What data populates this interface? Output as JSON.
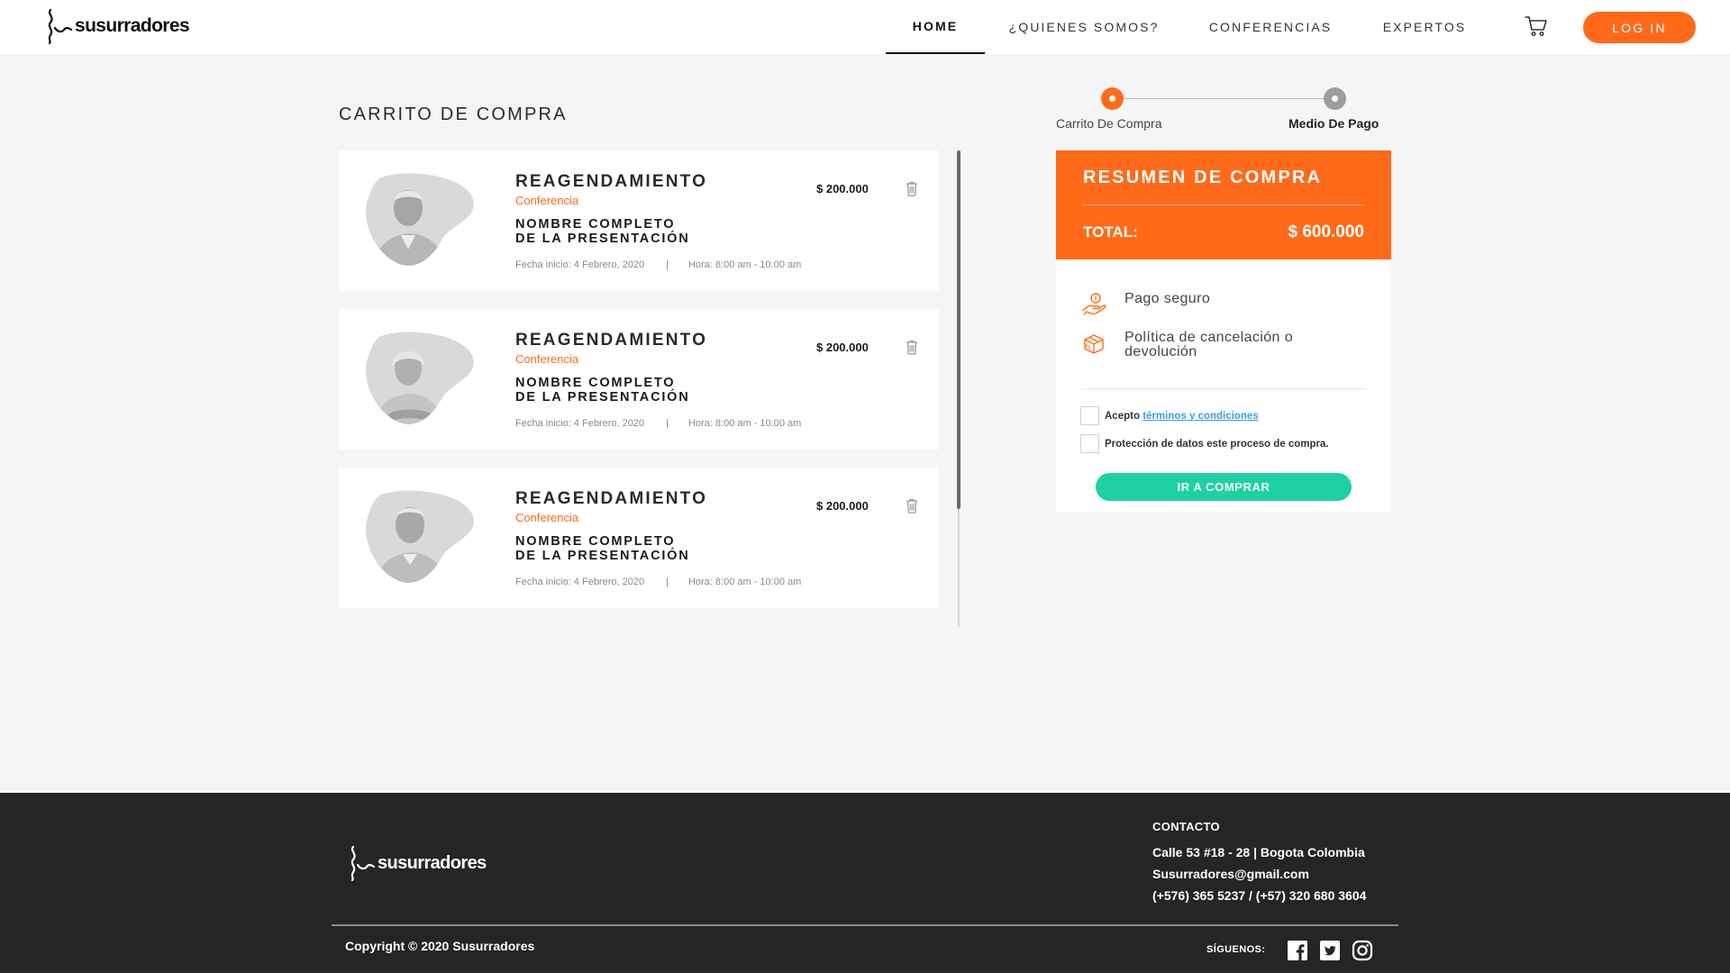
{
  "brand": {
    "name": "susurradores"
  },
  "nav": {
    "items": [
      {
        "label": "HOME"
      },
      {
        "label": "¿QUIENES SOMOS?"
      },
      {
        "label": "CONFERENCIAS"
      },
      {
        "label": "EXPERTOS"
      }
    ],
    "login_label": "LOG IN"
  },
  "icons": {
    "cart": "shopping-cart-icon",
    "trash": "trash-icon",
    "secure_payment": "hand-coin-icon",
    "cancellation": "box-return-icon",
    "facebook": "facebook-icon",
    "twitter": "twitter-icon",
    "instagram": "instagram-icon"
  },
  "colors": {
    "accent": "#ff6a1a",
    "success": "#1fd0a4",
    "footer": "#252525",
    "link": "#3aa0e0"
  },
  "page_title": "CARRITO DE COMPRA",
  "steps": [
    {
      "label": "Carrito De Compra"
    },
    {
      "label": "Medio De Pago"
    }
  ],
  "cart": {
    "items": [
      {
        "title": "REAGENDAMIENTO",
        "type": "Conferencia",
        "name_line1": "NOMBRE COMPLETO",
        "name_line2": "DE LA PRESENTACIÓN",
        "price": "$ 200.000",
        "date": "Fecha inicio: 4 Febrero, 2020",
        "sep": "|",
        "time": "Hora: 8:00 am - 10:00 am"
      },
      {
        "title": "REAGENDAMIENTO",
        "type": "Conferencia",
        "name_line1": "NOMBRE COMPLETO",
        "name_line2": "DE LA PRESENTACIÓN",
        "price": "$ 200.000",
        "date": "Fecha inicio: 4 Febrero, 2020",
        "sep": "|",
        "time": "Hora: 8:00 am - 10:00 am"
      },
      {
        "title": "REAGENDAMIENTO",
        "type": "Conferencia",
        "name_line1": "NOMBRE COMPLETO",
        "name_line2": "DE LA PRESENTACIÓN",
        "price": "$ 200.000",
        "date": "Fecha inicio: 4 Febrero, 2020",
        "sep": "|",
        "time": "Hora: 8:00 am - 10:00 am"
      }
    ]
  },
  "summary": {
    "title": "RESUMEN DE COMPRA",
    "total_label": "TOTAL:",
    "total_value": "$ 600.000",
    "features": [
      {
        "text_line1": "Pago seguro",
        "text_line2": ""
      },
      {
        "text_line1": "Política de cancelación o",
        "text_line2": "devolución"
      }
    ],
    "terms_prefix": "Acepto",
    "terms_link": "términos y condiciones",
    "data_protection": "Protección de datos este proceso de compra.",
    "buy_label": "IR A COMPRAR"
  },
  "footer": {
    "contact_title": "CONTACTO",
    "address": "Calle 53 #18 - 28 | Bogota Colombia",
    "email": "Susurradores@gmail.com",
    "phones": "(+576) 365 5237 / (+57) 320 680 3604",
    "copyright": "Copyright © 2020 Susurradores",
    "follow_label": "SÍGUENOS:"
  }
}
